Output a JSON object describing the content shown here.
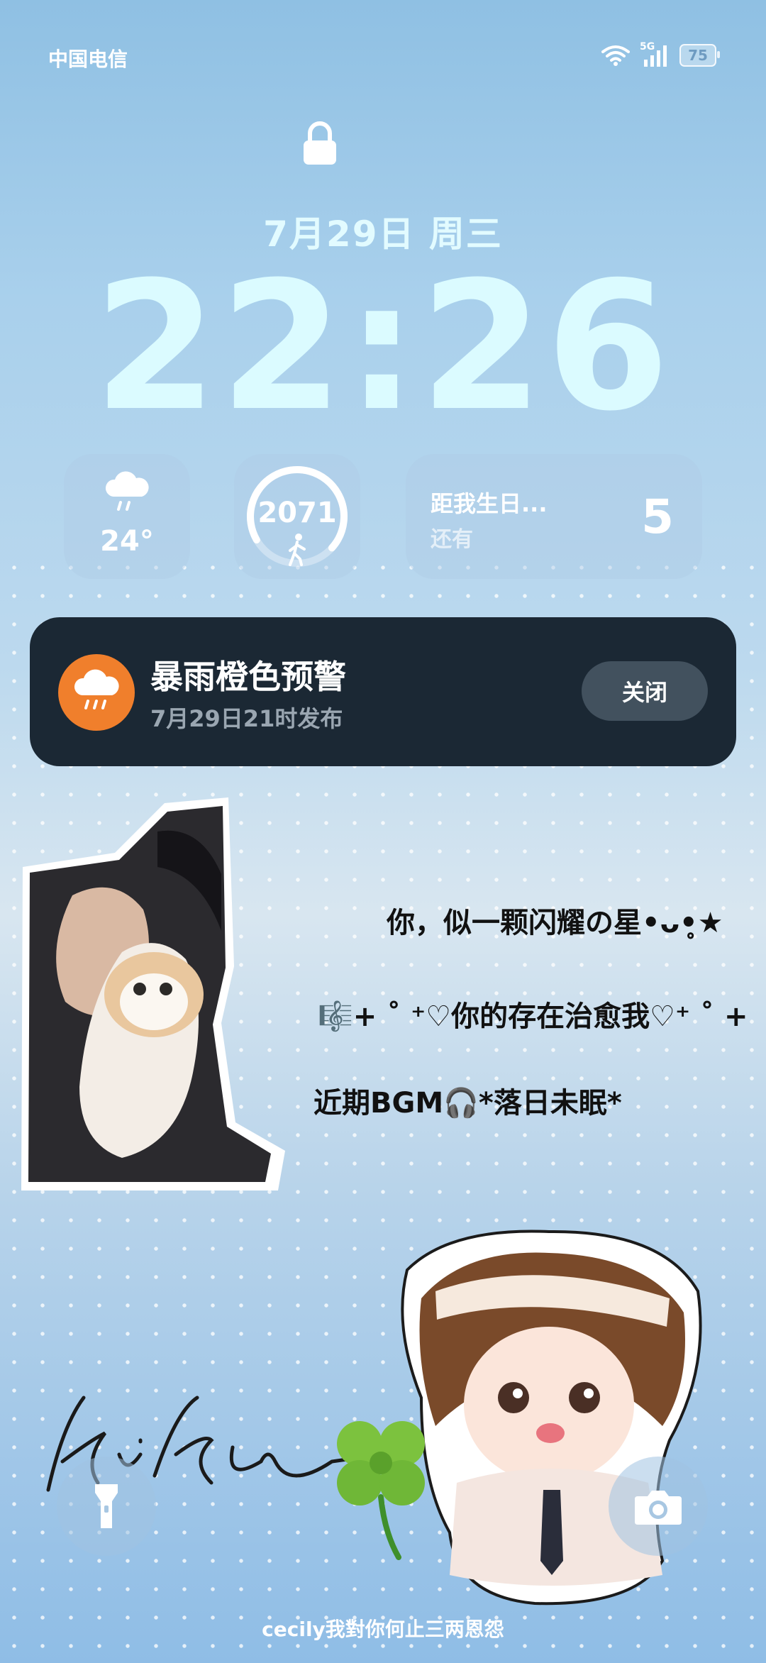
{
  "status_bar": {
    "carrier": "中国电信",
    "network": "5G",
    "battery": "75"
  },
  "lock_screen": {
    "date": "7月29日  周三",
    "time": "22:26"
  },
  "widgets": {
    "weather": {
      "icon": "rain-cloud-icon",
      "temperature": "24°"
    },
    "steps": {
      "icon": "walking-person-icon",
      "count": "2071",
      "progress": 0.7
    },
    "birthday": {
      "title": "距我生日...",
      "subtitle": "还有",
      "days": "5"
    }
  },
  "alert": {
    "icon": "rain-cloud-icon",
    "icon_color": "#f07f2c",
    "title": "暴雨橙色预警",
    "subtitle": "7月29日21时发布",
    "close_label": "关闭"
  },
  "wallpaper": {
    "text_lines": [
      "你，似一颗闪耀の星•ᴗ•̥★",
      "🎼+ ˚ ⁺♡你的存在治愈我♡⁺ ˚ +",
      "近期BGM🎧*落日未眠*"
    ],
    "signature": "kiku",
    "caption": "cecily我對你何止三两恩怨"
  },
  "quick_actions": {
    "flashlight": "flashlight-icon",
    "camera": "camera-icon"
  }
}
